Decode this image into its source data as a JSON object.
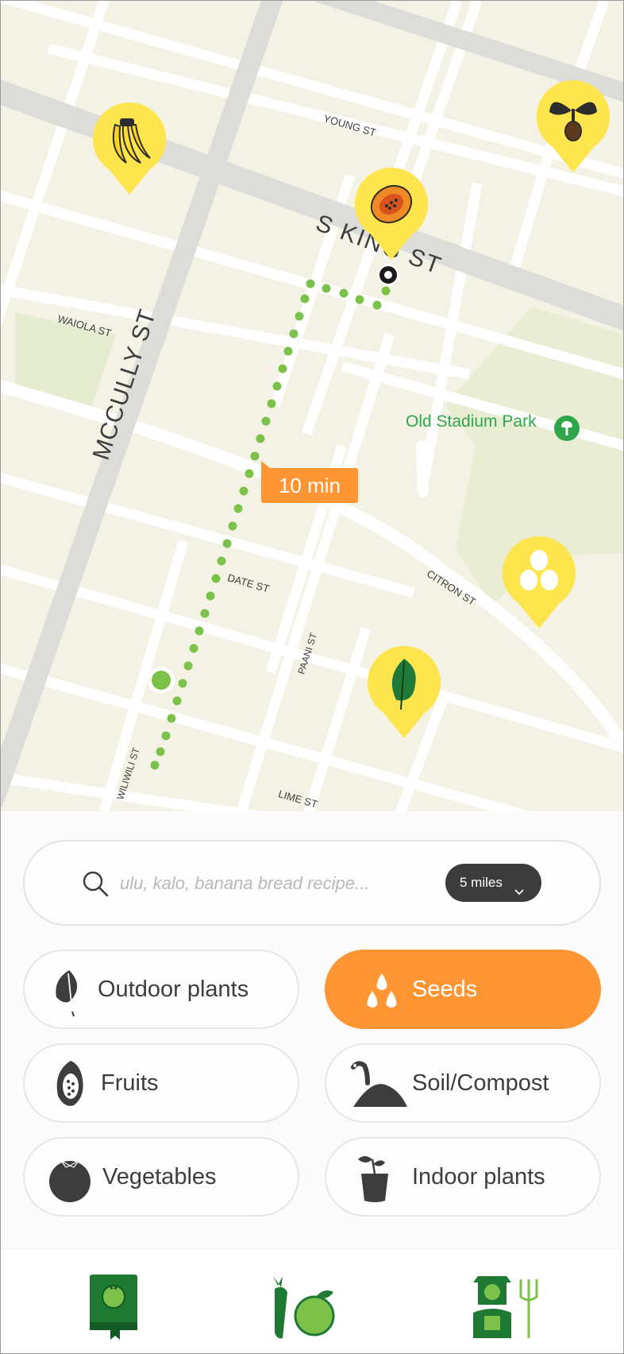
{
  "map": {
    "streets": {
      "young": "YOUNG ST",
      "s_king": "S KING ST",
      "waiola": "WAIOLA ST",
      "mccully": "MCCULLY ST",
      "date": "DATE ST",
      "citron": "CITRON ST",
      "paani": "PAANI ST",
      "wiliwili": "WILIWILI ST",
      "lime": "LIME ST"
    },
    "park": {
      "name": "Old Stadium Park",
      "icon": "tree-icon"
    },
    "route": {
      "duration": "10 min"
    },
    "pins": [
      "banana-pin",
      "papaya-pin",
      "taro-plant-pin",
      "eggs-pin",
      "leaf-pin"
    ]
  },
  "search": {
    "placeholder": "ulu, kalo, banana bread recipe...",
    "distance_label": "5 miles",
    "icon": "search-icon"
  },
  "categories": [
    {
      "label": "Outdoor plants",
      "icon": "outdoor-plant-icon",
      "active": false
    },
    {
      "label": "Seeds",
      "icon": "seeds-icon",
      "active": true
    },
    {
      "label": "Fruits",
      "icon": "papaya-icon",
      "active": false
    },
    {
      "label": "Soil/Compost",
      "icon": "worm-soil-icon",
      "active": false
    },
    {
      "label": "Vegetables",
      "icon": "tomato-icon",
      "active": false
    },
    {
      "label": "Indoor plants",
      "icon": "potted-sprout-icon",
      "active": false
    }
  ],
  "nav": [
    "recipe-book-icon",
    "produce-icon",
    "farmer-icon"
  ],
  "colors": {
    "accent": "#ff9633",
    "route": "#7cc24a",
    "pin": "#ffe54d",
    "park": "#2fa64b",
    "nav_green": "#1e7a33"
  }
}
